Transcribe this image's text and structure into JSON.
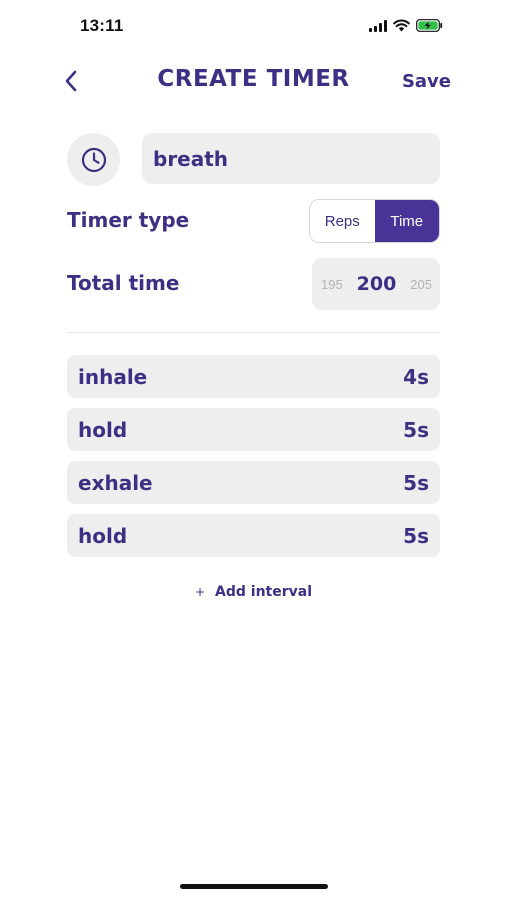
{
  "status_bar": {
    "time": "13:11",
    "icons": [
      "signal-icon",
      "wifi-icon",
      "battery-charging-icon"
    ]
  },
  "header": {
    "back_icon": "chevron-left-icon",
    "title": "CREATE TIMER",
    "save_label": "Save"
  },
  "name": {
    "icon": "clock-icon",
    "value": "breath"
  },
  "timer_type": {
    "label": "Timer type",
    "options": [
      "Reps",
      "Time"
    ],
    "selected": "Time"
  },
  "total_time": {
    "label": "Total time",
    "previous": "195",
    "current": "200",
    "next": "205"
  },
  "intervals": [
    {
      "name": "inhale",
      "duration": "4s"
    },
    {
      "name": "hold",
      "duration": "5s"
    },
    {
      "name": "exhale",
      "duration": "5s"
    },
    {
      "name": "hold",
      "duration": "5s"
    }
  ],
  "add_interval": {
    "icon": "plus-icon",
    "label": "Add interval"
  },
  "colors": {
    "accent": "#4a3396",
    "text": "#3f2f84",
    "field_bg": "#eeeeee"
  }
}
